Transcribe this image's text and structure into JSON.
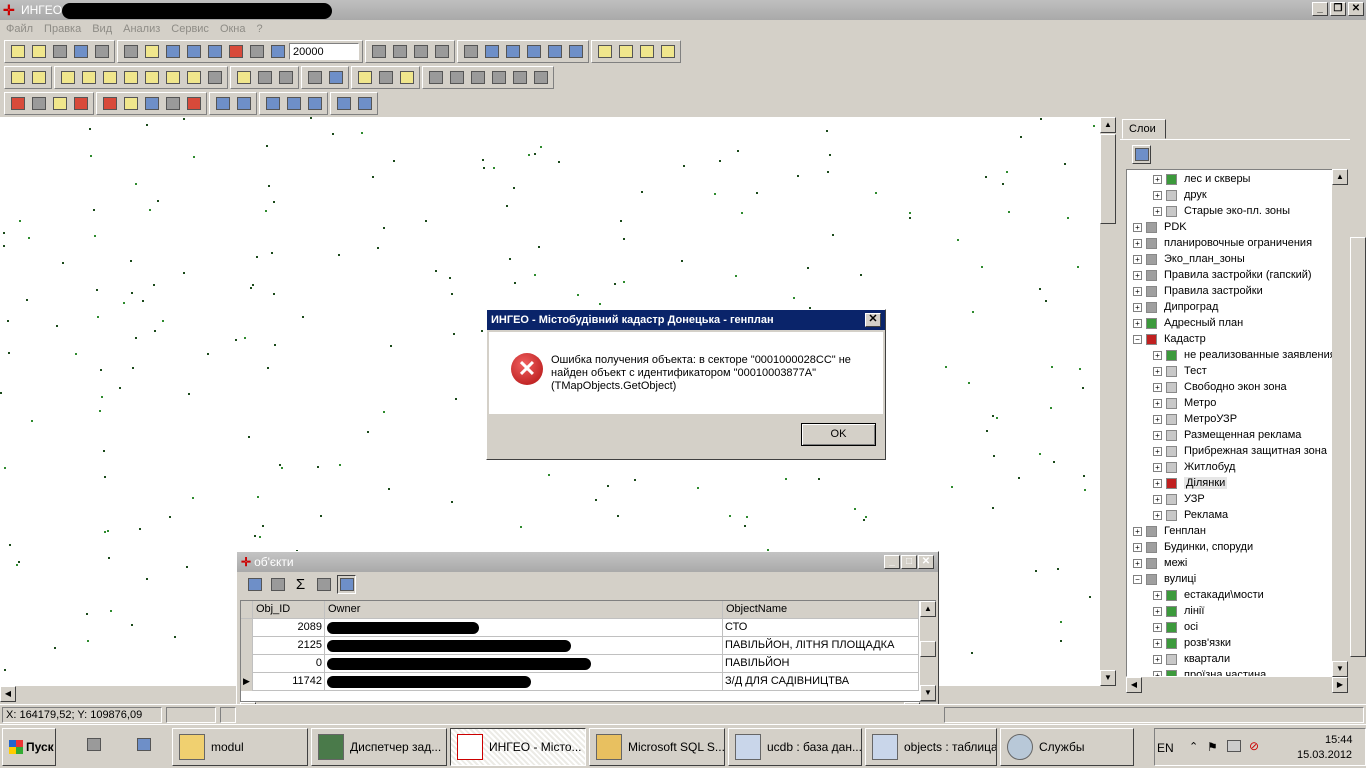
{
  "app": {
    "title": "ИНГЕО - "
  },
  "menu": [
    "Файл",
    "Правка",
    "Вид",
    "Анализ",
    "Сервис",
    "Окна",
    "?"
  ],
  "toolbar": {
    "scale_value": "20000"
  },
  "layers_panel": {
    "tab_label": "Слои",
    "items": [
      {
        "label": "лес и скверы",
        "icon": "green",
        "level": 1
      },
      {
        "label": "друк",
        "icon": "gray",
        "level": 1
      },
      {
        "label": "Старые эко-пл. зоны",
        "icon": "gray",
        "level": 1
      },
      {
        "label": "PDK",
        "icon": "stack",
        "level": 0
      },
      {
        "label": "планировочные ограничения",
        "icon": "stack",
        "level": 0
      },
      {
        "label": "Эко_план_зоны",
        "icon": "stack",
        "level": 0
      },
      {
        "label": "Правила застройки (гапский)",
        "icon": "stack",
        "level": 0
      },
      {
        "label": "Правила застройки",
        "icon": "stack",
        "level": 0
      },
      {
        "label": "Дипроград",
        "icon": "stack",
        "level": 0
      },
      {
        "label": "Адресный план",
        "icon": "green",
        "level": 0
      },
      {
        "label": "Кадастр",
        "icon": "red",
        "level": 0,
        "expanded": true
      },
      {
        "label": "не реализованные заявления",
        "icon": "green",
        "level": 1
      },
      {
        "label": "Тест",
        "icon": "gray",
        "level": 1
      },
      {
        "label": "Свободно экон зона",
        "icon": "gray",
        "level": 1
      },
      {
        "label": "Метро",
        "icon": "gray",
        "level": 1
      },
      {
        "label": "МетроУЗР",
        "icon": "gray",
        "level": 1
      },
      {
        "label": "Размещенная реклама",
        "icon": "gray",
        "level": 1
      },
      {
        "label": "Прибрежная защитная зона",
        "icon": "gray",
        "level": 1
      },
      {
        "label": "Житлобуд",
        "icon": "gray",
        "level": 1
      },
      {
        "label": "Ділянки",
        "icon": "red",
        "level": 1,
        "selected": true
      },
      {
        "label": "УЗР",
        "icon": "gray",
        "level": 1
      },
      {
        "label": "Реклама",
        "icon": "gray",
        "level": 1
      },
      {
        "label": "Генплан",
        "icon": "stack",
        "level": 0
      },
      {
        "label": "Будинки, споруди",
        "icon": "stack",
        "level": 0
      },
      {
        "label": "межі",
        "icon": "stack",
        "level": 0
      },
      {
        "label": "вулиці",
        "icon": "stack",
        "level": 0,
        "expanded": true
      },
      {
        "label": "естакади\\мости",
        "icon": "green",
        "level": 1
      },
      {
        "label": "лінії",
        "icon": "green",
        "level": 1
      },
      {
        "label": "осі",
        "icon": "green",
        "level": 1
      },
      {
        "label": "розв'язки",
        "icon": "green",
        "level": 1
      },
      {
        "label": "квартали",
        "icon": "gray",
        "level": 1
      },
      {
        "label": "проїзна частина",
        "icon": "green",
        "level": 1
      }
    ]
  },
  "dialog": {
    "title": "ИНГЕО - Містобудівний кадастр Донецька - генплан",
    "message": "Ошибка получения объекта: в секторе \"0001000028CC\" не найден объект с идентификатором \"00010003877A\" (TMapObjects.GetObject)",
    "ok_label": "OK"
  },
  "objects_window": {
    "title": "об'єкти",
    "columns": [
      "Obj_ID",
      "Owner",
      "ObjectName"
    ],
    "rows": [
      {
        "id": "2089",
        "name": "СТО"
      },
      {
        "id": "2125",
        "name": "ПАВІЛЬЙОН, ЛІТНЯ ПЛОЩАДКА"
      },
      {
        "id": "0",
        "name": "ПАВІЛЬЙОН"
      },
      {
        "id": "11742",
        "name": "З/Д ДЛЯ САДІВНИЦТВА",
        "current": true
      }
    ]
  },
  "status": {
    "coords": "X: 164179,52; Y: 109876,09"
  },
  "taskbar": {
    "start_label": "Пуск",
    "buttons": [
      {
        "label": "modul"
      },
      {
        "label": "Диспетчер зад..."
      },
      {
        "label": "ИНГЕО - Місто...",
        "active": true
      },
      {
        "label": "Microsoft SQL S..."
      },
      {
        "label": "ucdb : база дан..."
      },
      {
        "label": "objects : таблица"
      },
      {
        "label": "Службы"
      }
    ],
    "lang": "EN",
    "time": "15:44",
    "date": "15.03.2012"
  }
}
